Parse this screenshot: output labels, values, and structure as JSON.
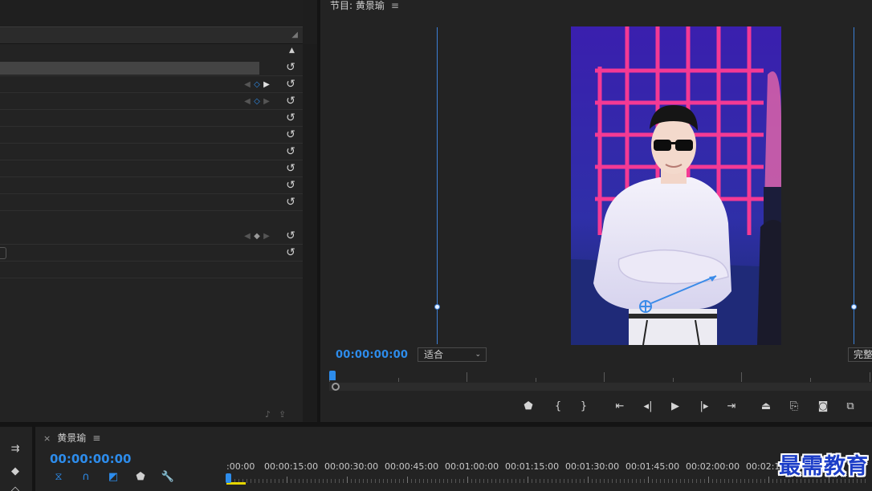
{
  "program_monitor": {
    "title": "节目: 黄景瑜",
    "menu_icon": "hamburger-icon",
    "timecode": "00:00:00:00",
    "fit_label": "适合",
    "full_label": "完整"
  },
  "timeline": {
    "sequence_name": "黄景瑜",
    "close_glyph": "×",
    "menu_glyph": "≡",
    "timecode": "00:00:00:00",
    "ruler_labels": [
      ":00:00",
      "00:00:15:00",
      "00:00:30:00",
      "00:00:45:00",
      "00:01:00:00",
      "00:01:15:00",
      "00:01:30:00",
      "00:01:45:00",
      "00:02:00:00",
      "00:02:15:00"
    ]
  },
  "watermark": "最需教育",
  "colors": {
    "accent": "#2d8ceb",
    "guide": "#3b7fd6",
    "in_out_bar": "#e6d600"
  },
  "icons": {
    "reset": "reset-icon",
    "keyframe": "keyframe-icon",
    "play": "play-icon",
    "wrench": "wrench-icon",
    "camera": "camera-icon",
    "magnet": "snap-magnet-icon"
  }
}
